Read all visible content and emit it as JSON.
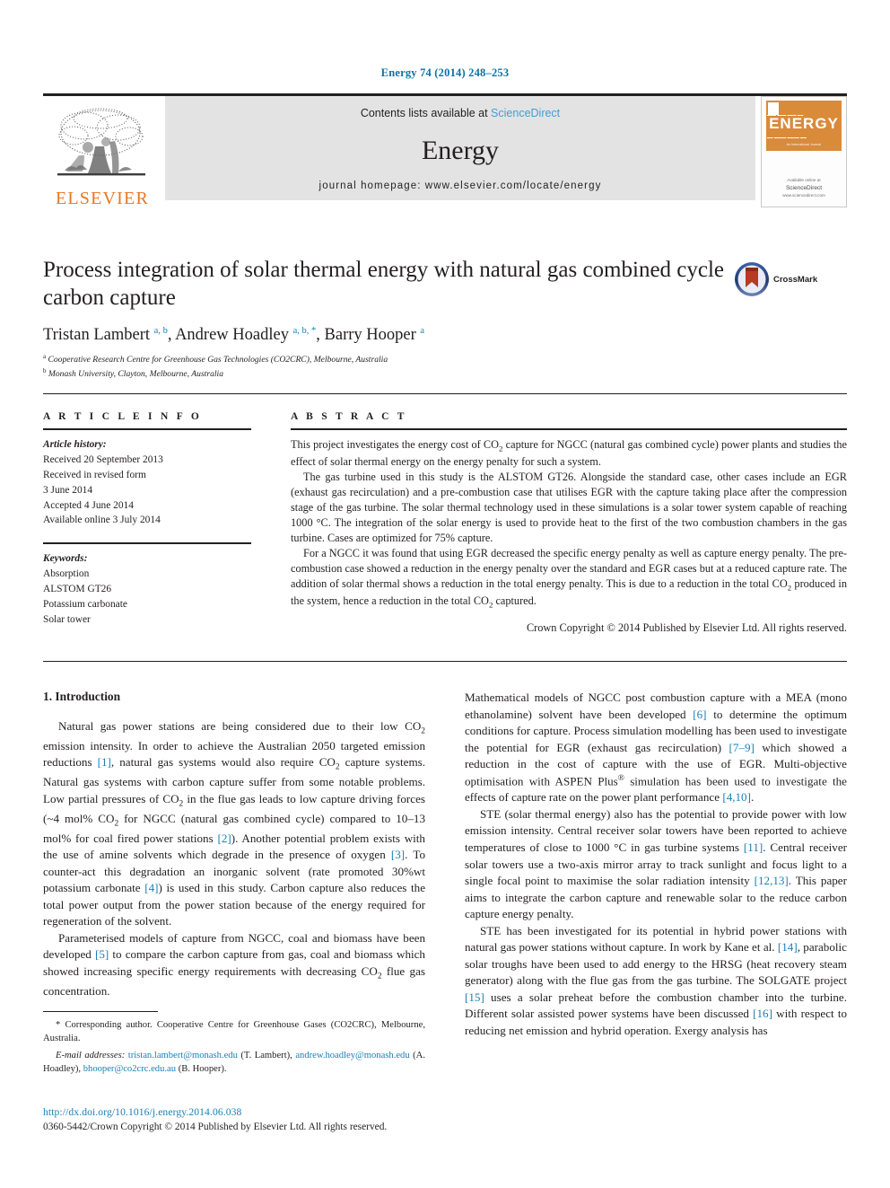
{
  "running_head": "Energy 74 (2014) 248–253",
  "masthead": {
    "publisher": "ELSEVIER",
    "contents_prefix": "Contents lists available at ",
    "contents_link": "ScienceDirect",
    "journal_name": "Energy",
    "homepage": "journal homepage: www.elsevier.com/locate/energy",
    "cover": {
      "title": "ENERGY",
      "footer_line1": "Available online at",
      "footer_line2": "ScienceDirect",
      "footer_line3": "www.sciencedirect.com",
      "banner_text": "An International Journal"
    },
    "link_color": "#3e9fd4",
    "elsevier_orange": "#e87722"
  },
  "article": {
    "title": "Process integration of solar thermal energy with natural gas combined cycle carbon capture",
    "crossmark_label": "CrossMark",
    "authors_html": "Tristan Lambert <sup>a, b</sup>, Andrew Hoadley <sup>a, b, *</sup>, Barry Hooper <sup>a</sup>",
    "affiliations": [
      {
        "marker": "a",
        "text": "Cooperative Research Centre for Greenhouse Gas Technologies (CO2CRC), Melbourne, Australia"
      },
      {
        "marker": "b",
        "text": "Monash University, Clayton, Melbourne, Australia"
      }
    ]
  },
  "article_info": {
    "heading": "A R T I C L E   I N F O",
    "history_label": "Article history:",
    "history": [
      "Received 20 September 2013",
      "Received in revised form",
      "3 June 2014",
      "Accepted 4 June 2014",
      "Available online 3 July 2014"
    ],
    "keywords_label": "Keywords:",
    "keywords": [
      "Absorption",
      "ALSTOM GT26",
      "Potassium carbonate",
      "Solar tower"
    ]
  },
  "abstract": {
    "heading": "A B S T R A C T",
    "paragraphs": [
      "This project investigates the energy cost of CO2 capture for NGCC (natural gas combined cycle) power plants and studies the effect of solar thermal energy on the energy penalty for such a system.",
      "The gas turbine used in this study is the ALSTOM GT26. Alongside the standard case, other cases include an EGR (exhaust gas recirculation) and a pre-combustion case that utilises EGR with the capture taking place after the compression stage of the gas turbine. The solar thermal technology used in these simulations is a solar tower system capable of reaching 1000 °C. The integration of the solar energy is used to provide heat to the first of the two combustion chambers in the gas turbine. Cases are optimized for 75% capture.",
      "For a NGCC it was found that using EGR decreased the specific energy penalty as well as capture energy penalty. The pre-combustion case showed a reduction in the energy penalty over the standard and EGR cases but at a reduced capture rate. The addition of solar thermal shows a reduction in the total energy penalty. This is due to a reduction in the total CO2 produced in the system, hence a reduction in the total CO2 captured."
    ],
    "copyright": "Crown Copyright © 2014 Published by Elsevier Ltd. All rights reserved."
  },
  "introduction": {
    "heading": "1.  Introduction",
    "left_paragraphs": [
      "Natural gas power stations are being considered due to their low CO2 emission intensity. In order to achieve the Australian 2050 targeted emission reductions [1], natural gas systems would also require CO2 capture systems. Natural gas systems with carbon capture suffer from some notable problems. Low partial pressures of CO2 in the flue gas leads to low capture driving forces (~4 mol% CO2 for NGCC (natural gas combined cycle) compared to 10–13 mol% for coal fired power stations [2]). Another potential problem exists with the use of amine solvents which degrade in the presence of oxygen [3]. To counter-act this degradation an inorganic solvent (rate promoted 30%wt potassium carbonate [4]) is used in this study. Carbon capture also reduces the total power output from the power station because of the energy required for regeneration of the solvent.",
      "Parameterised models of capture from NGCC, coal and biomass have been developed [5] to compare the carbon capture from gas, coal and biomass which showed increasing specific energy requirements with decreasing CO2 flue gas concentration."
    ],
    "right_paragraphs": [
      "Mathematical models of NGCC post combustion capture with a MEA (mono ethanolamine) solvent have been developed [6] to determine the optimum conditions for capture. Process simulation modelling has been used to investigate the potential for EGR (exhaust gas recirculation) [7–9] which showed a reduction in the cost of capture with the use of EGR. Multi-objective optimisation with ASPEN Plus® simulation has been used to investigate the effects of capture rate on the power plant performance [4,10].",
      "STE (solar thermal energy) also has the potential to provide power with low emission intensity. Central receiver solar towers have been reported to achieve temperatures of close to 1000 °C in gas turbine systems [11]. Central receiver solar towers use a two-axis mirror array to track sunlight and focus light to a single focal point to maximise the solar radiation intensity [12,13]. This paper aims to integrate the carbon capture and renewable solar to the reduce carbon capture energy penalty.",
      "STE has been investigated for its potential in hybrid power stations with natural gas power stations without capture. In work by Kane et al. [14], parabolic solar troughs have been used to add energy to the HRSG (heat recovery steam generator) along with the flue gas from the gas turbine. The SOLGATE project [15] uses a solar preheat before the combustion chamber into the turbine. Different solar assisted power systems have been discussed [16] with respect to reducing net emission and hybrid operation. Exergy analysis has"
    ]
  },
  "footnotes": {
    "corresponding": "* Corresponding author. Cooperative Centre for Greenhouse Gases (CO2CRC), Melbourne, Australia.",
    "email_label": "E-mail addresses:",
    "emails": [
      {
        "address": "tristan.lambert@monash.edu",
        "owner": "(T. Lambert)"
      },
      {
        "address": "andrew.hoadley@monash.edu",
        "owner": "(A. Hoadley)"
      },
      {
        "address": "bhooper@co2crc.edu.au",
        "owner": "(B. Hooper)"
      }
    ],
    "doi": "http://dx.doi.org/10.1016/j.energy.2014.06.038",
    "issn_line": "0360-5442/Crown Copyright © 2014 Published by Elsevier Ltd. All rights reserved."
  }
}
